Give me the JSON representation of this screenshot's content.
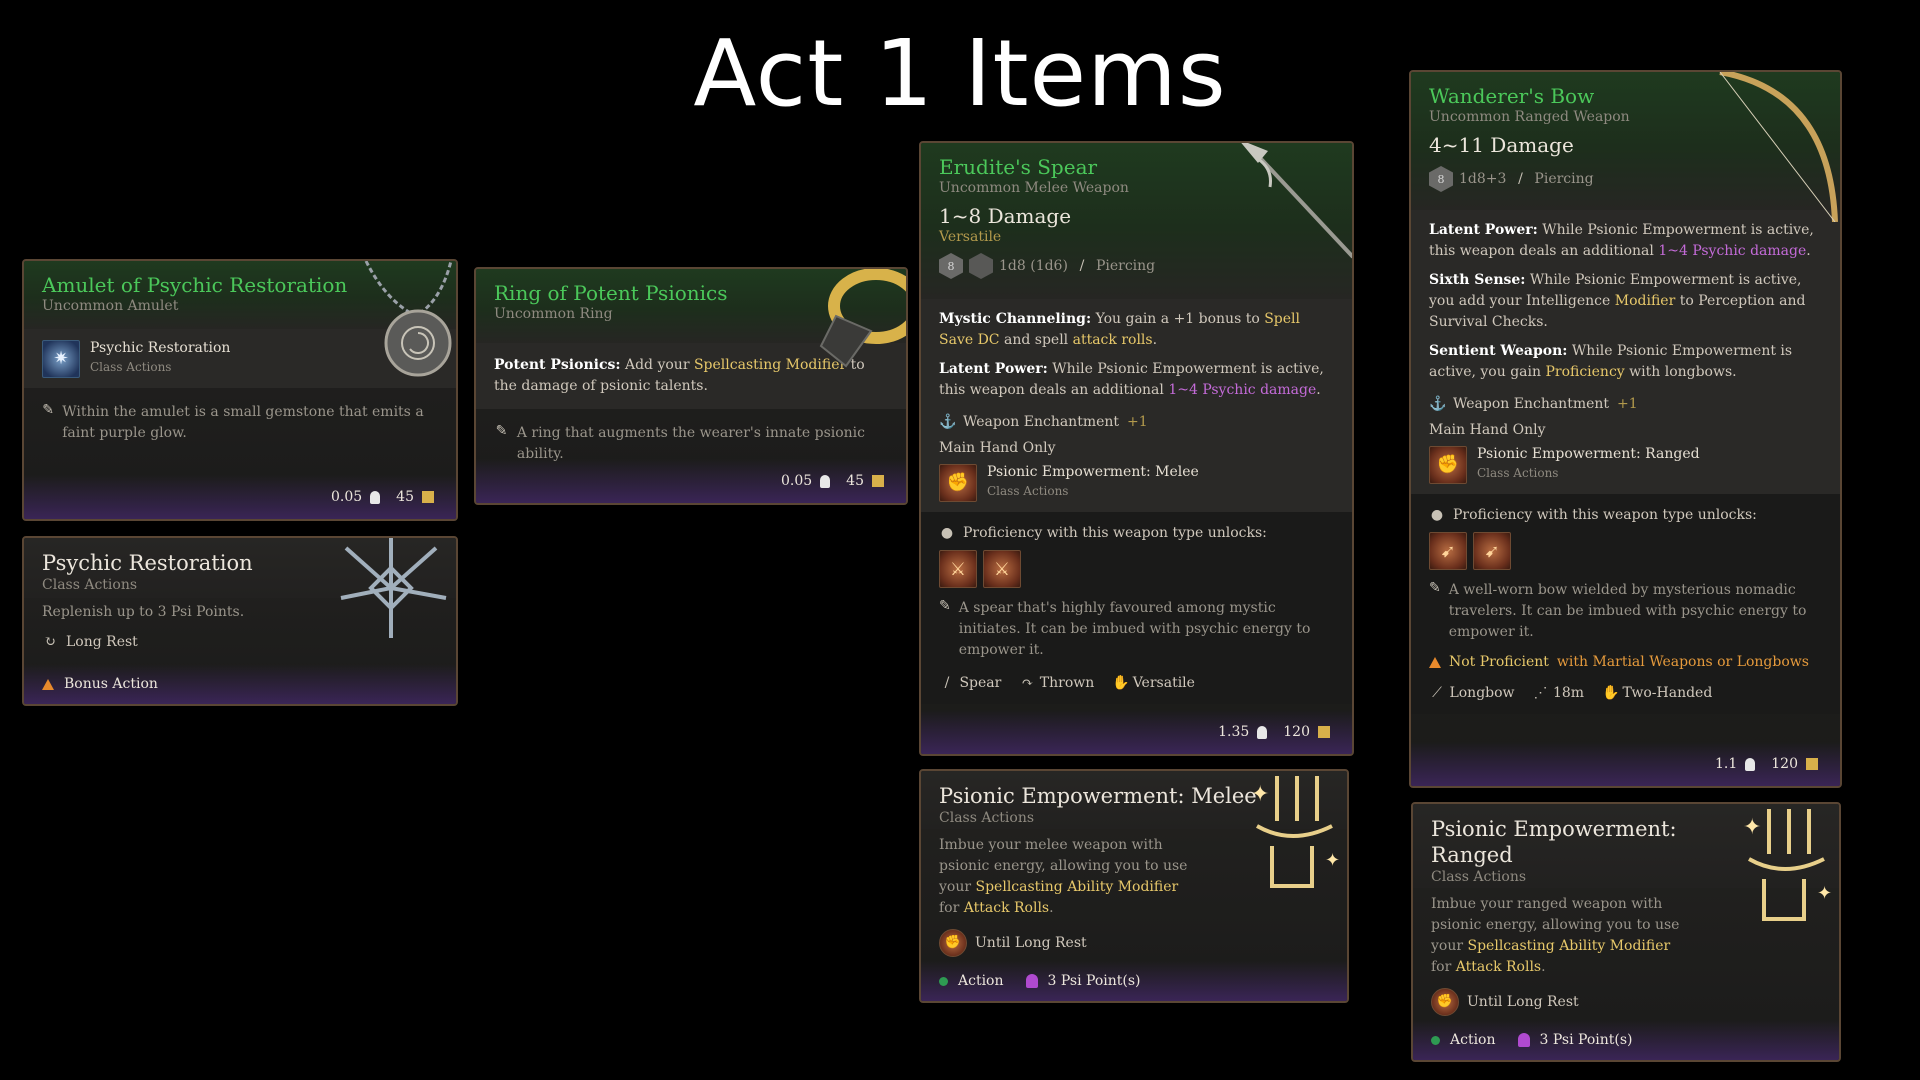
{
  "page_title": "Act 1 Items",
  "amulet": {
    "name": "Amulet of Psychic Restoration",
    "type": "Uncommon Amulet",
    "ability": {
      "name": "Psychic Restoration",
      "type": "Class Actions"
    },
    "description": "Within the amulet is a small gemstone that emits a faint purple glow.",
    "weight": "0.05",
    "price": "45"
  },
  "psychic_restoration": {
    "name": "Psychic Restoration",
    "type": "Class Actions",
    "text": "Replenish up to 3 Psi Points.",
    "recharge": "Long Rest",
    "cost": "Bonus Action"
  },
  "ring": {
    "name": "Ring of Potent Psionics",
    "type": "Uncommon Ring",
    "prop_name": "Potent Psionics:",
    "prop_text_a": "Add your",
    "prop_link_a": "Spellcasting Modifier",
    "prop_text_b": "to the damage of psionic talents.",
    "description": "A ring that augments the wearer's innate psionic ability.",
    "weight": "0.05",
    "price": "45"
  },
  "spear": {
    "name": "Erudite's Spear",
    "type": "Uncommon Melee Weapon",
    "damage": "1~8 Damage",
    "versatile": "Versatile",
    "die_label": "8",
    "dice": "1d8 (1d6)",
    "damage_type": "Piercing",
    "mystic_name": "Mystic Channeling:",
    "mystic_a": "You gain a +1 bonus to",
    "mystic_link_a": "Spell Save DC",
    "mystic_b": "and spell",
    "mystic_link_b": "attack rolls",
    "mystic_c": ".",
    "latent_name": "Latent Power:",
    "latent_a": "While Psionic Empowerment is active, this weapon deals an additional",
    "latent_link": "1~4 Psychic damage",
    "latent_b": ".",
    "enchant": "Weapon Enchantment",
    "enchant_val": "+1",
    "hand": "Main Hand Only",
    "ability": {
      "name": "Psionic Empowerment: Melee",
      "type": "Class Actions"
    },
    "prof": "Proficiency with this weapon type unlocks:",
    "description": "A spear that's highly favoured among mystic initiates. It can be imbued with psychic energy to empower it.",
    "tags": [
      "Spear",
      "Thrown",
      "Versatile"
    ],
    "weight": "1.35",
    "price": "120"
  },
  "melee": {
    "name": "Psionic Empowerment: Melee",
    "type": "Class Actions",
    "text_a": "Imbue your melee weapon with psionic energy, allowing you to use your",
    "link_a": "Spellcasting Ability Modifier",
    "text_b": "for",
    "link_b": "Attack Rolls",
    "text_c": ".",
    "duration": "Until Long Rest",
    "cost_action": "Action",
    "cost_psi": "3 Psi Point(s)"
  },
  "bow": {
    "name": "Wanderer's Bow",
    "type": "Uncommon Ranged Weapon",
    "damage": "4~11 Damage",
    "die_label": "8",
    "dice": "1d8+3",
    "damage_type": "Piercing",
    "latent_name": "Latent Power:",
    "latent_a": "While Psionic Empowerment is active, this weapon deals an additional",
    "latent_link": "1~4 Psychic damage",
    "latent_b": ".",
    "sixth_name": "Sixth Sense:",
    "sixth_a": "While Psionic Empowerment is active, you add your Intelligence",
    "sixth_link": "Modifier",
    "sixth_b": "to Perception and Survival Checks.",
    "sentient_name": "Sentient Weapon:",
    "sentient_a": "While Psionic Empowerment is active, you gain",
    "sentient_link": "Proficiency",
    "sentient_b": "with longbows.",
    "enchant": "Weapon Enchantment",
    "enchant_val": "+1",
    "hand": "Main Hand Only",
    "ability": {
      "name": "Psionic Empowerment: Ranged",
      "type": "Class Actions"
    },
    "prof": "Proficiency with this weapon type unlocks:",
    "description": "A well-worn bow wielded by mysterious nomadic travelers. It can be imbued with psychic energy to empower it.",
    "warn_a": "Not Proficient",
    "warn_b": "with Martial Weapons or Longbows",
    "tags": [
      "Longbow",
      "18m",
      "Two-Handed"
    ],
    "weight": "1.1",
    "price": "120"
  },
  "ranged": {
    "name": "Psionic Empowerment: Ranged",
    "type": "Class Actions",
    "text_a": "Imbue your ranged weapon with psionic energy, allowing you to use your",
    "link_a": "Spellcasting Ability Modifier",
    "text_b": "for",
    "link_b": "Attack Rolls",
    "text_c": ".",
    "duration": "Until Long Rest",
    "cost_action": "Action",
    "cost_psi": "3 Psi Point(s)"
  }
}
